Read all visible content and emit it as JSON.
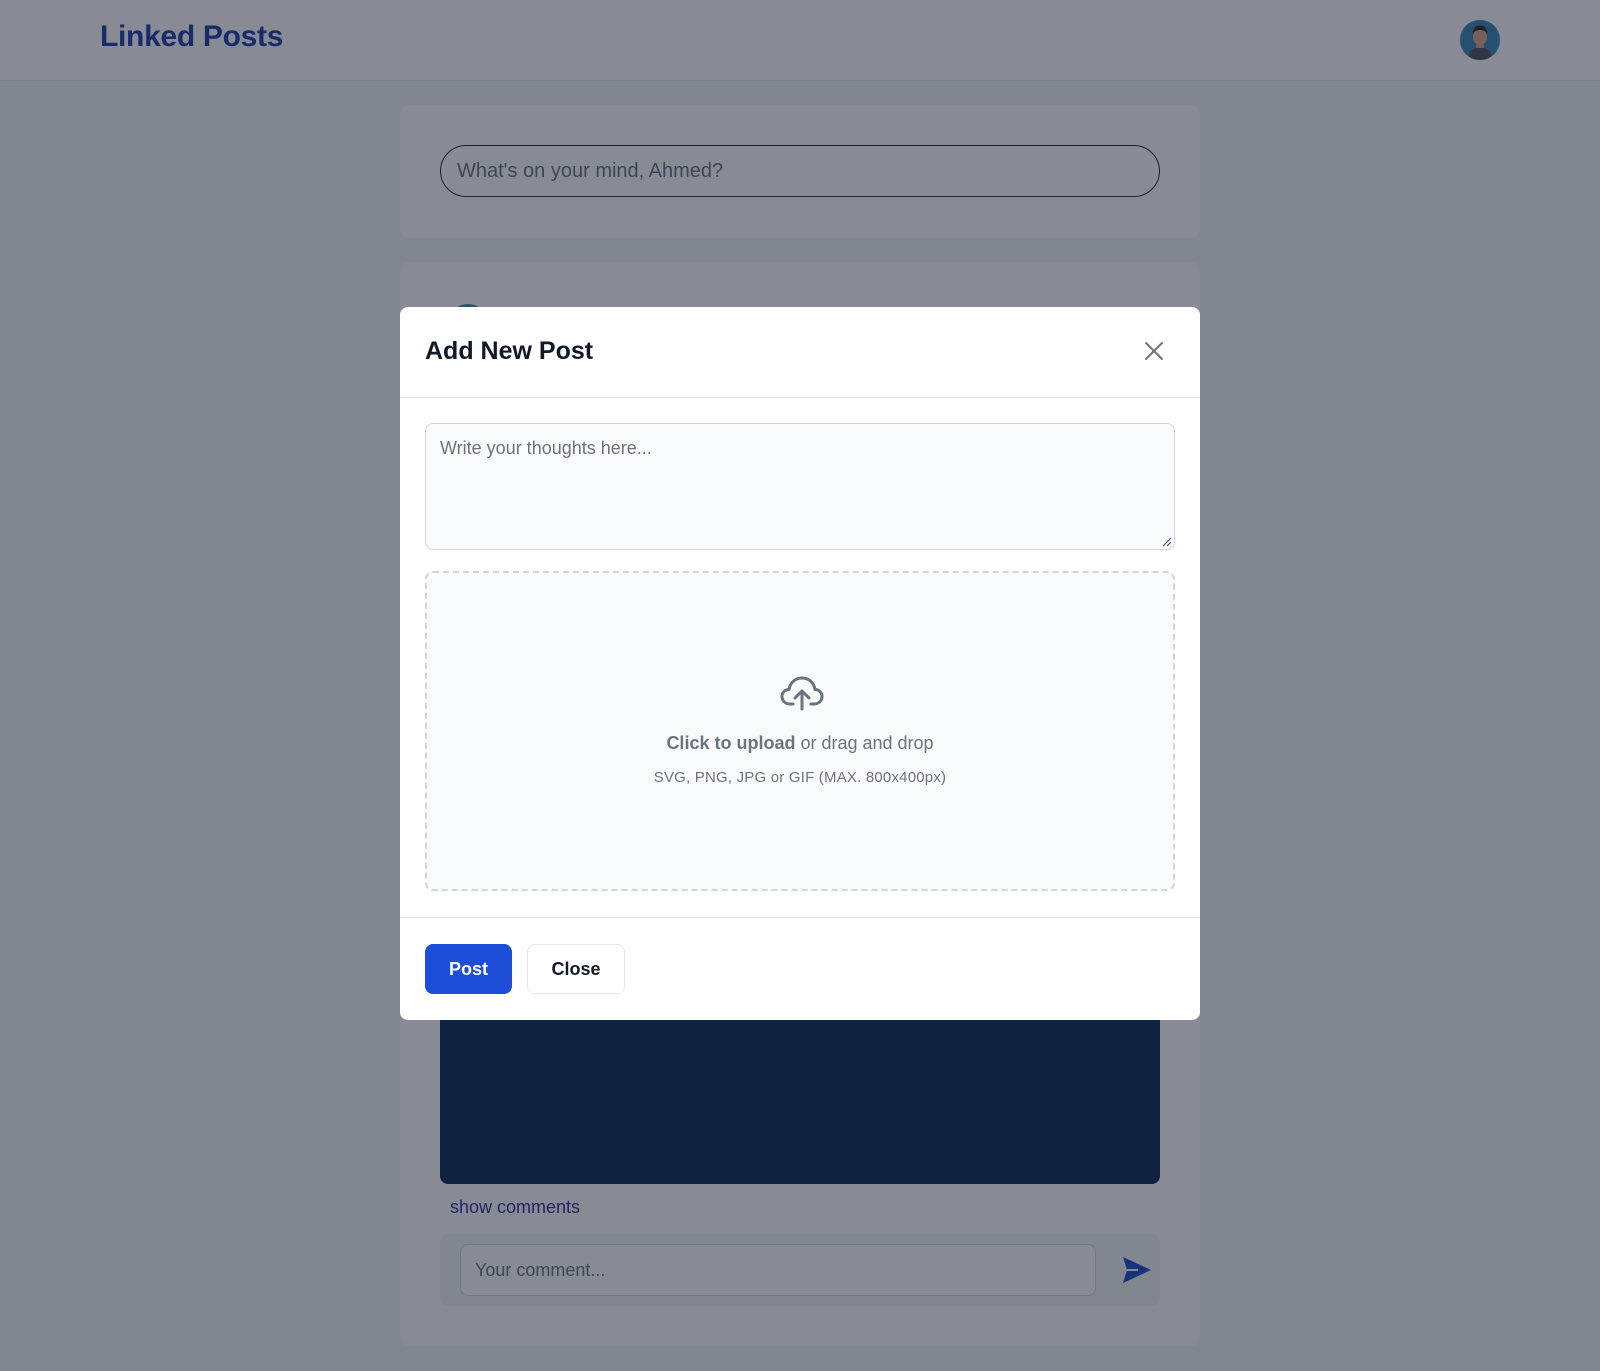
{
  "navbar": {
    "brand": "Linked Posts",
    "avatar_icon": "user-avatar-icon"
  },
  "composer": {
    "placeholder": "What's on your mind, Ahmed?"
  },
  "post": {
    "show_comments_label": "show comments",
    "comment_placeholder": "Your comment...",
    "send_icon": "send-icon"
  },
  "modal": {
    "title": "Add New Post",
    "textarea_placeholder": "Write your thoughts here...",
    "upload": {
      "click_text": "Click to upload",
      "drag_text": " or drag and drop",
      "hint": "SVG, PNG, JPG or GIF (MAX. 800x400px)",
      "icon": "cloud-upload-icon"
    },
    "post_button": "Post",
    "close_button": "Close"
  },
  "colors": {
    "brand": "#1e40af",
    "primary_button": "#1d4ed8",
    "post_image": "#0b2e57",
    "overlay": "rgba(17,24,39,0.5)"
  }
}
